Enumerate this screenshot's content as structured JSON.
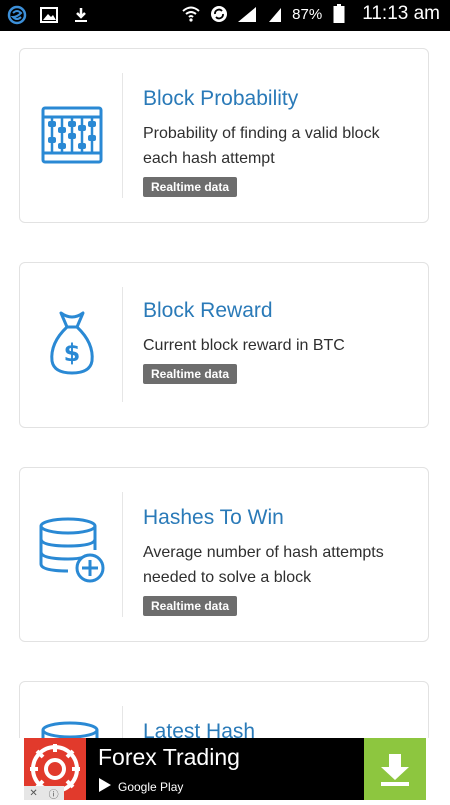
{
  "status_bar": {
    "battery_percent": "87%",
    "time": "11:13 am",
    "icons": [
      "app-s-icon",
      "image-icon",
      "download-icon",
      "wifi-icon",
      "sync-icon",
      "signal-icon",
      "battery-icon"
    ]
  },
  "cards": [
    {
      "icon": "abacus-icon",
      "title": "Block Probability",
      "description": "Probability of finding a valid block each hash attempt",
      "badge": "Realtime data"
    },
    {
      "icon": "money-bag-icon",
      "title": "Block Reward",
      "description": "Current block reward in BTC",
      "badge": "Realtime data"
    },
    {
      "icon": "database-add-icon",
      "title": "Hashes To Win",
      "description": "Average number of hash attempts needed to solve a block",
      "badge": "Realtime data"
    },
    {
      "icon": "database-icon",
      "title": "Latest Hash",
      "description": "",
      "badge": ""
    }
  ],
  "ad": {
    "title": "Forex Trading",
    "store": "Google Play",
    "colors": {
      "logo": "#e13a2c",
      "download": "#8dc63f",
      "background": "#000000"
    }
  },
  "colors": {
    "accent": "#2a7ab8",
    "badge": "#6d6d6d"
  }
}
